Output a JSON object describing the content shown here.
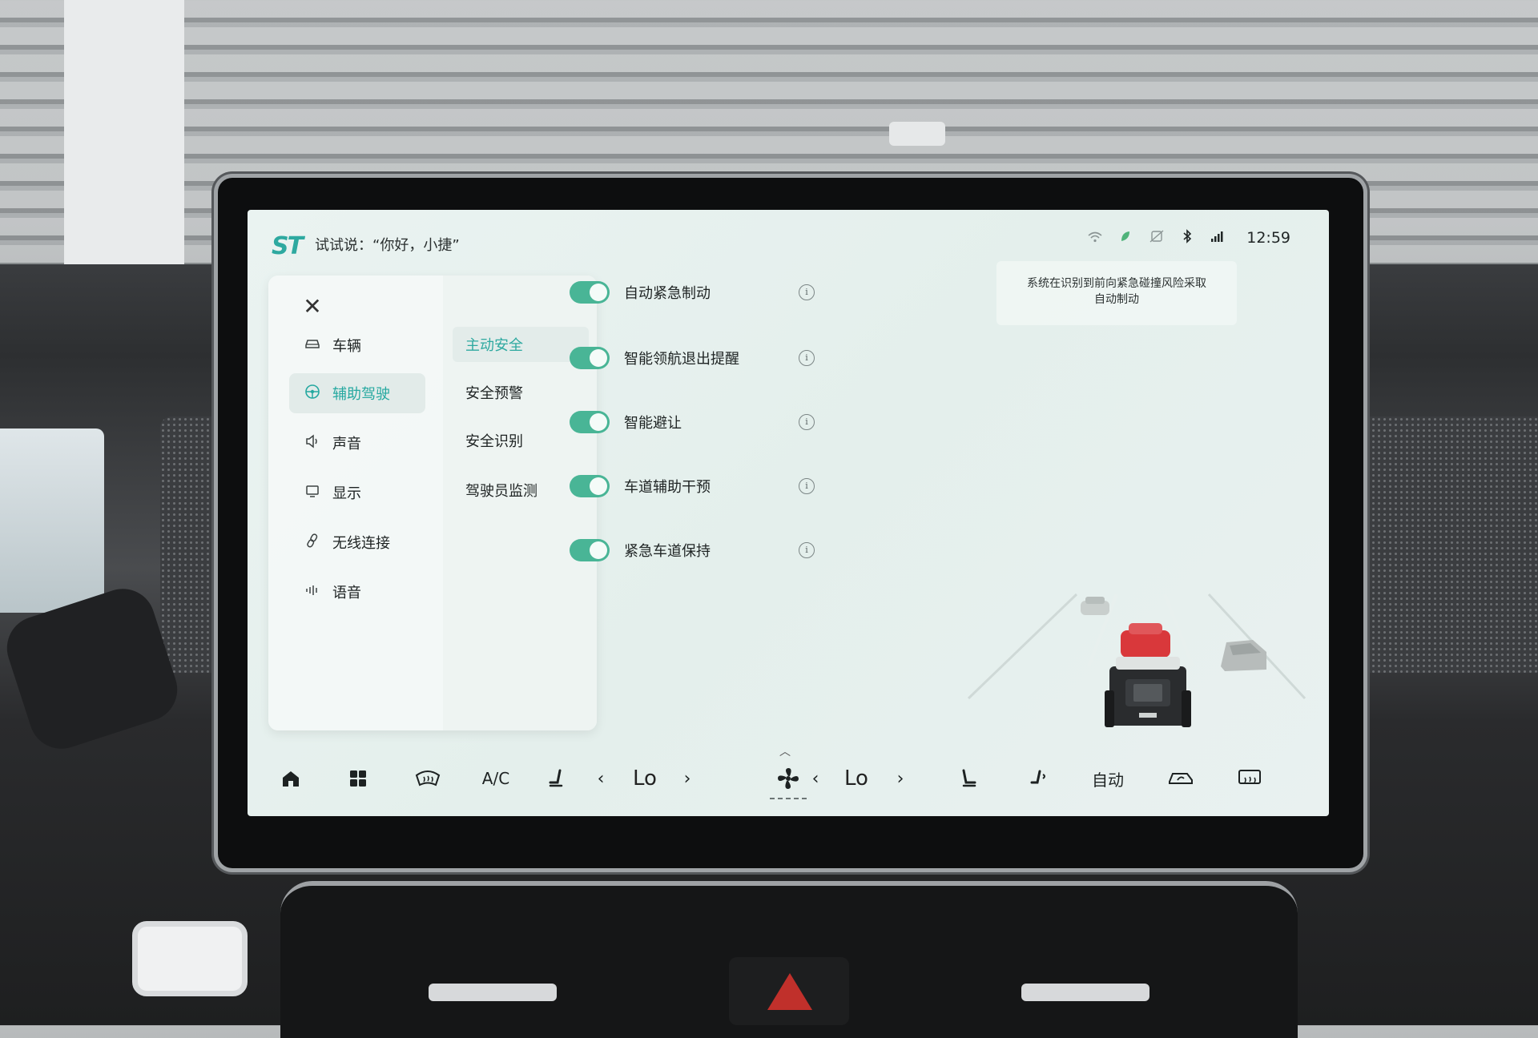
{
  "status_bar": {
    "brand": "ST",
    "voice_hint": "试试说：“你好，小捷”",
    "time": "12:59",
    "icons": [
      "wifi-icon",
      "eco-icon",
      "phone-off-icon",
      "bluetooth-icon",
      "signal-4g-icon"
    ]
  },
  "panel": {
    "close_label": "✕",
    "nav": [
      {
        "label": "车辆",
        "icon": "car-icon"
      },
      {
        "label": "辅助驾驶",
        "icon": "steering-wheel-icon",
        "active": true
      },
      {
        "label": "声音",
        "icon": "speaker-icon"
      },
      {
        "label": "显示",
        "icon": "display-icon"
      },
      {
        "label": "无线连接",
        "icon": "link-icon"
      },
      {
        "label": "语音",
        "icon": "voice-wave-icon"
      }
    ],
    "subnav": [
      {
        "label": "主动安全",
        "active": true
      },
      {
        "label": "安全预警"
      },
      {
        "label": "安全识别"
      },
      {
        "label": "驾驶员监测"
      }
    ]
  },
  "features": [
    {
      "label": "自动紧急制动",
      "enabled": true
    },
    {
      "label": "智能领航退出提醒",
      "enabled": true
    },
    {
      "label": "智能避让",
      "enabled": true
    },
    {
      "label": "车道辅助干预",
      "enabled": true
    },
    {
      "label": "紧急车道保持",
      "enabled": true
    }
  ],
  "tooltip": {
    "line1": "系统在识别到前向紧急碰撞风险采取",
    "line2": "自动制动"
  },
  "dock": {
    "ac_label": "A/C",
    "temp_left": "Lo",
    "temp_right": "Lo",
    "auto_label": "自动",
    "prev_arrow": "‹",
    "next_arrow": "›"
  }
}
